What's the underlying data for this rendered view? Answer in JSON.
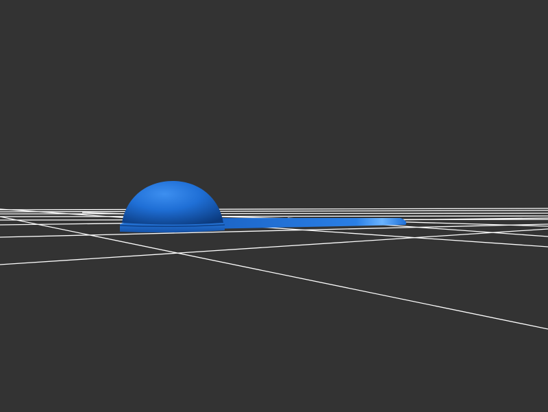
{
  "viewport": {
    "background_color": "#333333",
    "grid_color": "#ffffff",
    "show_grid": true
  },
  "model": {
    "shape": "dome on disc base with flat tab",
    "color": "#1f6fd6",
    "dark_color": "#0d3f86",
    "highlight_color": "#5aa8ff"
  }
}
